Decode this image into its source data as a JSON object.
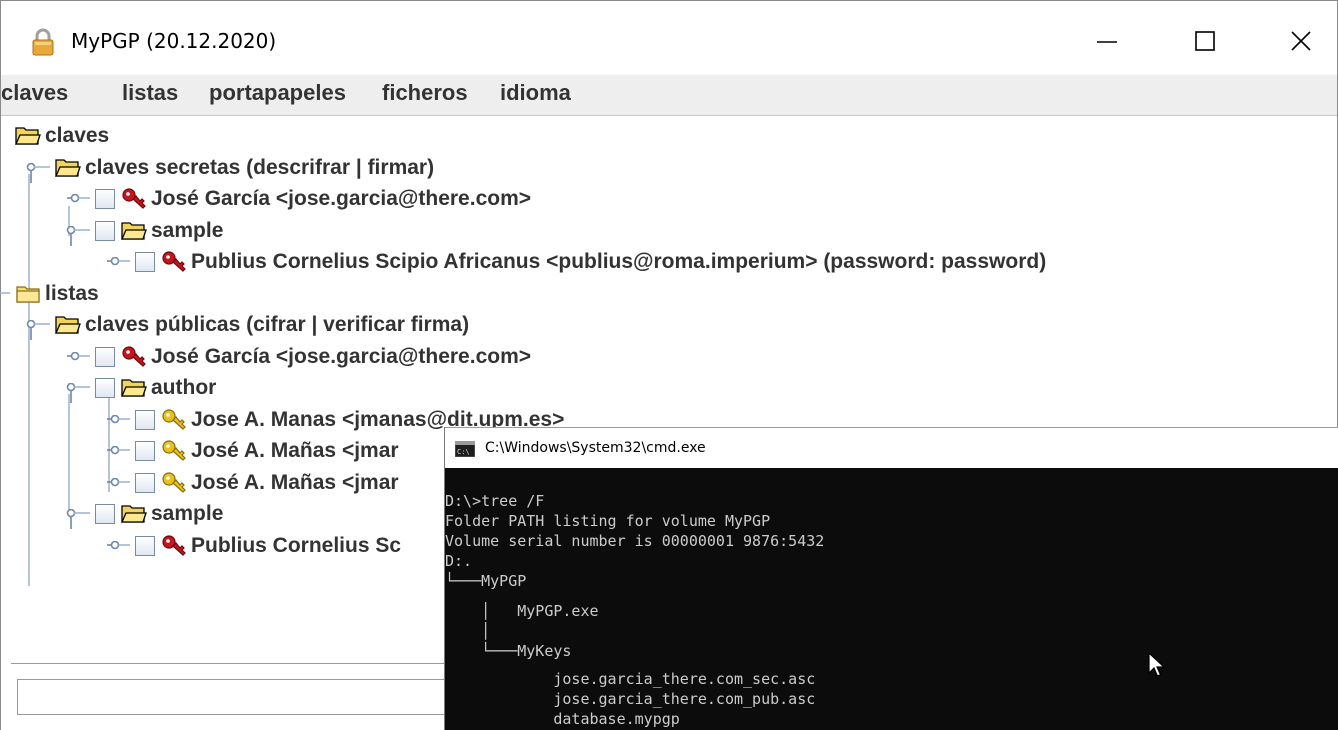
{
  "window": {
    "title": "MyPGP (20.12.2020)"
  },
  "menu": [
    "claves",
    "listas",
    "portapapeles",
    "ficheros",
    "idioma"
  ],
  "tree": [
    {
      "label": "claves",
      "icon": "folder-open",
      "checkbox": false
    },
    {
      "label": "claves secretas (descrifrar | firmar)",
      "icon": "folder-open",
      "checkbox": false
    },
    {
      "label": "José García <jose.garcia@there.com>",
      "icon": "key-red",
      "checkbox": true
    },
    {
      "label": "sample",
      "icon": "folder-open",
      "checkbox": true
    },
    {
      "label": "Publius Cornelius Scipio Africanus <publius@roma.imperium> (password: password)",
      "icon": "key-red",
      "checkbox": true
    },
    {
      "label": "listas",
      "icon": "folder-closed",
      "checkbox": false
    },
    {
      "label": "claves públicas (cifrar | verificar firma)",
      "icon": "folder-open",
      "checkbox": false
    },
    {
      "label": "José García <jose.garcia@there.com>",
      "icon": "key-red",
      "checkbox": true
    },
    {
      "label": "author",
      "icon": "folder-open",
      "checkbox": true
    },
    {
      "label": "Jose A. Manas <jmanas@dit.upm.es>",
      "icon": "key-yellow",
      "checkbox": true
    },
    {
      "label": "José A. Mañas <jmar",
      "icon": "key-yellow",
      "checkbox": true
    },
    {
      "label": "José A. Mañas <jmar",
      "icon": "key-yellow",
      "checkbox": true
    },
    {
      "label": "sample",
      "icon": "folder-open",
      "checkbox": true
    },
    {
      "label": "Publius Cornelius Sc",
      "icon": "key-red",
      "checkbox": true
    }
  ],
  "cmd": {
    "title": "C:\\Windows\\System32\\cmd.exe",
    "lines": [
      "D:\\>tree /F",
      "Folder PATH listing for volume MyPGP",
      "Volume serial number is 00000001 9876:5432",
      "D:.",
      "└───MyPGP",
      "    │   MyPGP.exe",
      "    │",
      "    └───MyKeys",
      "            jose.garcia_there.com_sec.asc",
      "            jose.garcia_there.com_pub.asc",
      "            database.mypgp"
    ]
  },
  "colors": {
    "key_red": "#c8141e",
    "key_yellow": "#e6c21a",
    "folder": "#f3d45a",
    "tree_line": "#9bb0cf"
  }
}
